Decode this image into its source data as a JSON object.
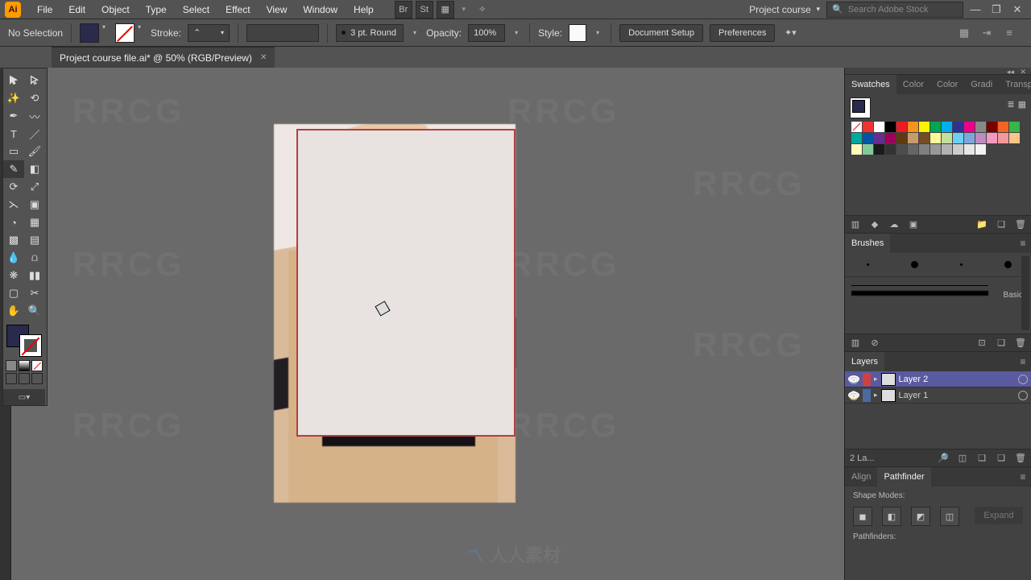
{
  "menu": {
    "items": [
      "File",
      "Edit",
      "Object",
      "Type",
      "Select",
      "Effect",
      "View",
      "Window",
      "Help"
    ],
    "workspace": "Project course",
    "search_placeholder": "Search Adobe Stock"
  },
  "control": {
    "selection_label": "No Selection",
    "stroke_label": "Stroke:",
    "brush_preset": "3 pt. Round",
    "opacity_label": "Opacity:",
    "opacity_value": "100%",
    "style_label": "Style:",
    "doc_setup": "Document Setup",
    "preferences": "Preferences"
  },
  "tab": {
    "title": "Project course file.ai* @ 50% (RGB/Preview)"
  },
  "panels": {
    "swatches": {
      "tabs": [
        "Swatches",
        "Color",
        "Color",
        "Gradi",
        "Transp"
      ],
      "active": 0
    },
    "brushes": {
      "title": "Brushes",
      "basic_label": "Basic"
    },
    "layers": {
      "title": "Layers",
      "rows": [
        {
          "name": "Layer 2",
          "color": "#d04040",
          "locked": false
        },
        {
          "name": "Layer 1",
          "color": "#4a6aa0",
          "locked": true
        }
      ],
      "footer": "2 La..."
    },
    "align": {
      "tabs": [
        "Align",
        "Pathfinder"
      ],
      "active": 1,
      "shape_modes_label": "Shape Modes:",
      "pathfinders_label": "Pathfinders:",
      "expand_label": "Expand"
    }
  },
  "swatch_colors": [
    "#ffffff",
    "#000000",
    "#ed1c24",
    "#f7941d",
    "#fff200",
    "#00a651",
    "#00aeef",
    "#2e3192",
    "#ec008c",
    "#898989",
    "#790000",
    "#f26522",
    "#39b54a",
    "#00a99d",
    "#0054a6",
    "#662d91",
    "#9e005d",
    "#603913",
    "#c69c6d",
    "#754c24",
    "#fff799",
    "#c4df9b",
    "#6dcff6",
    "#7da7d9",
    "#bd8cbf",
    "#f49ac1",
    "#f5989d",
    "#fdc689",
    "#fff9bd",
    "#82ca9c",
    "#1a1a1a",
    "#333333",
    "#4d4d4d",
    "#666666",
    "#808080",
    "#999999",
    "#b3b3b3",
    "#cccccc",
    "#e6e6e6",
    "#f2f2f2"
  ],
  "watermark_text": "RRCG",
  "wm_logo_cn": "人人素材"
}
